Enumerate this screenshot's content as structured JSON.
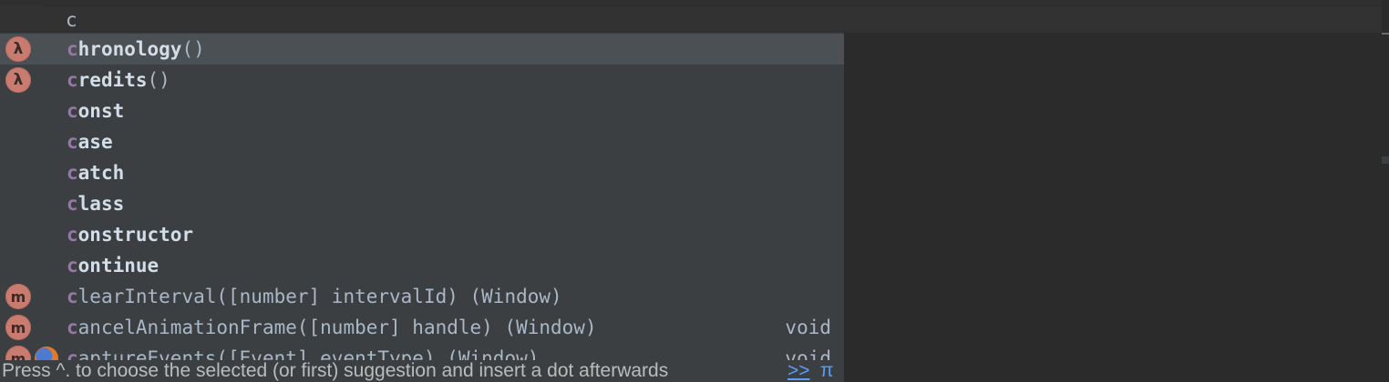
{
  "editor": {
    "typed_text": "c"
  },
  "completion": {
    "items": [
      {
        "icon": "lambda-icon",
        "icon_glyph": "λ",
        "match": "c",
        "name": "hronology",
        "params": "()",
        "type": "",
        "selected": true
      },
      {
        "icon": "lambda-icon",
        "icon_glyph": "λ",
        "match": "c",
        "name": "redits",
        "params": "()",
        "type": "",
        "selected": false
      },
      {
        "icon": "",
        "icon_glyph": "",
        "match": "c",
        "name": "onst",
        "params": "",
        "type": "",
        "selected": false
      },
      {
        "icon": "",
        "icon_glyph": "",
        "match": "c",
        "name": "ase",
        "params": "",
        "type": "",
        "selected": false
      },
      {
        "icon": "",
        "icon_glyph": "",
        "match": "c",
        "name": "atch",
        "params": "",
        "type": "",
        "selected": false
      },
      {
        "icon": "",
        "icon_glyph": "",
        "match": "c",
        "name": "lass",
        "params": "",
        "type": "",
        "selected": false
      },
      {
        "icon": "",
        "icon_glyph": "",
        "match": "c",
        "name": "onstructor",
        "params": "",
        "type": "",
        "selected": false
      },
      {
        "icon": "",
        "icon_glyph": "",
        "match": "c",
        "name": "ontinue",
        "params": "",
        "type": "",
        "selected": false
      },
      {
        "icon": "method-icon",
        "icon_glyph": "m",
        "match": "c",
        "name": "learInterval",
        "params": "([number] intervalId) (Window)",
        "type": "",
        "selected": false
      },
      {
        "icon": "method-icon",
        "icon_glyph": "m",
        "match": "c",
        "name": "ancelAnimationFrame",
        "params": "([number] handle) (Window)",
        "type": "void",
        "selected": false
      },
      {
        "icon": "method-icon",
        "icon_glyph": "m",
        "match": "c",
        "name": "aptureEvents",
        "params": "([Event] eventType) (Window)",
        "type": "void",
        "selected": false,
        "browser_icon": "firefox-icon"
      }
    ]
  },
  "status": {
    "hint": "Press ^. to choose the selected (or first) suggestion and insert a dot afterwards",
    "more_link": ">>",
    "pi_glyph": "π"
  },
  "colors": {
    "editor_bg": "#2b2b2b",
    "popup_bg": "#3c3f41",
    "selected_bg": "#4b5054",
    "match_highlight": "#9876aa",
    "icon_bg": "#c97b6f",
    "link": "#589df6"
  }
}
